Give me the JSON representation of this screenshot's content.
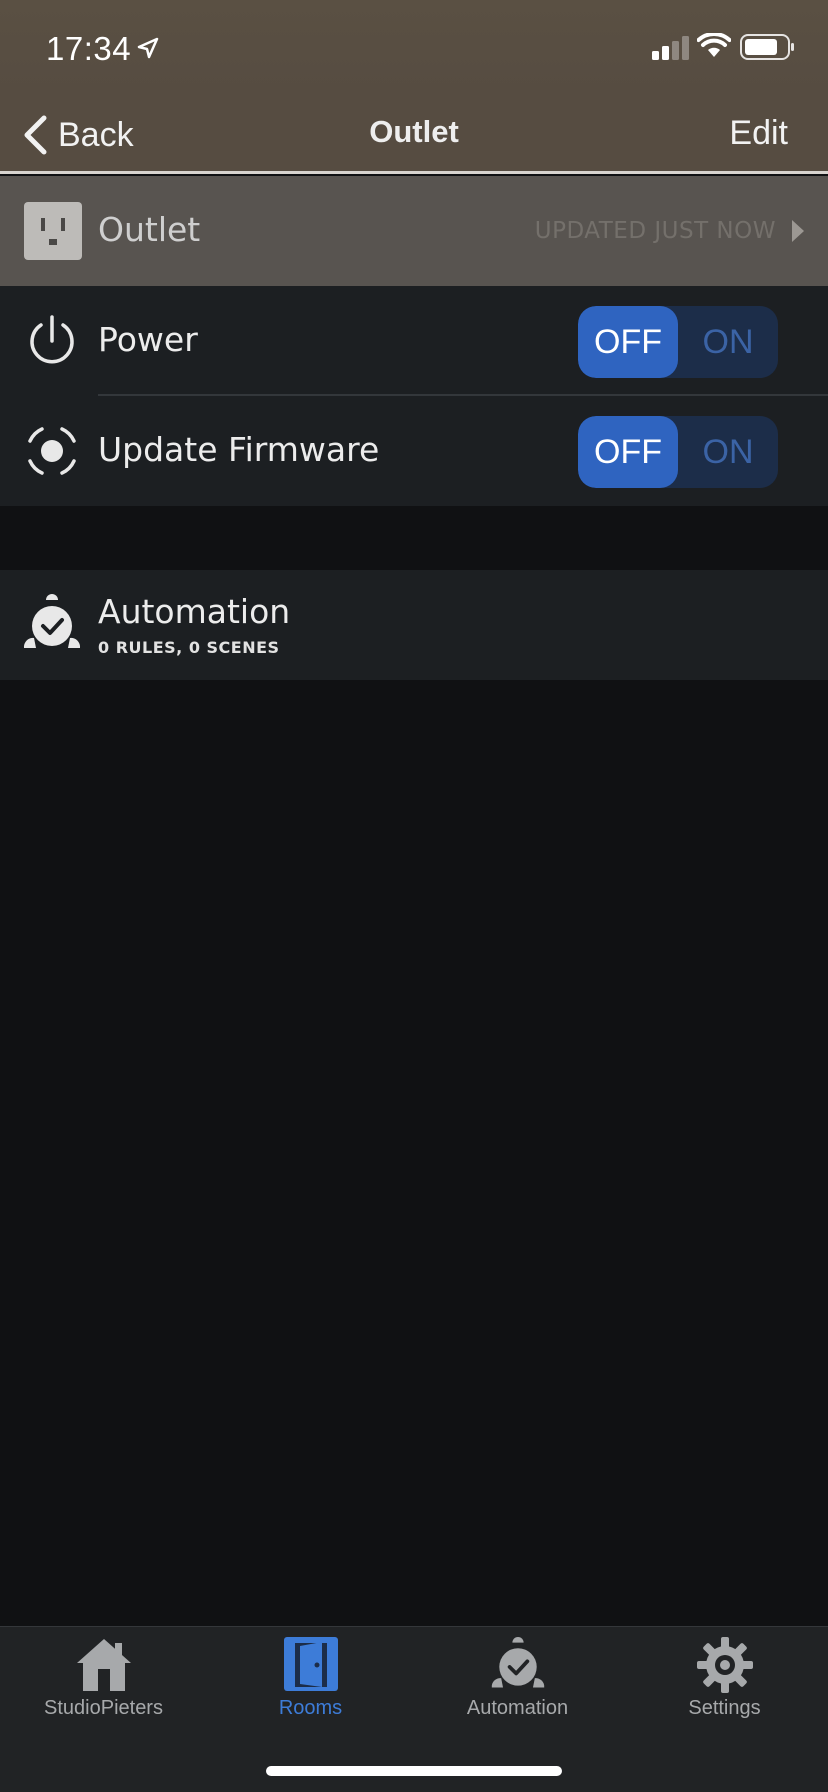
{
  "status_bar": {
    "time": "17:34",
    "icons": [
      "location-arrow-icon",
      "signal-icon",
      "wifi-icon",
      "battery-icon"
    ]
  },
  "nav": {
    "back_label": "Back",
    "title": "Outlet",
    "edit_label": "Edit"
  },
  "device": {
    "name": "Outlet",
    "updated": "UPDATED JUST NOW",
    "icon": "outlet-icon"
  },
  "controls": [
    {
      "label": "Power",
      "icon": "power-icon",
      "off_label": "OFF",
      "on_label": "ON",
      "state": "OFF"
    },
    {
      "label": "Update Firmware",
      "icon": "firmware-icon",
      "off_label": "OFF",
      "on_label": "ON",
      "state": "OFF"
    }
  ],
  "automation": {
    "title": "Automation",
    "subtitle": "0 RULES, 0 SCENES",
    "icon": "alarm-clock-icon"
  },
  "tabs": [
    {
      "label": "StudioPieters",
      "icon": "house-icon",
      "active": false
    },
    {
      "label": "Rooms",
      "icon": "door-icon",
      "active": true
    },
    {
      "label": "Automation",
      "icon": "alarm-clock-icon",
      "active": false
    },
    {
      "label": "Settings",
      "icon": "gear-icon",
      "active": false
    }
  ],
  "colors": {
    "accent": "#2f64c0",
    "active_tab": "#3d7cd8",
    "nav_background": "#564c41"
  }
}
